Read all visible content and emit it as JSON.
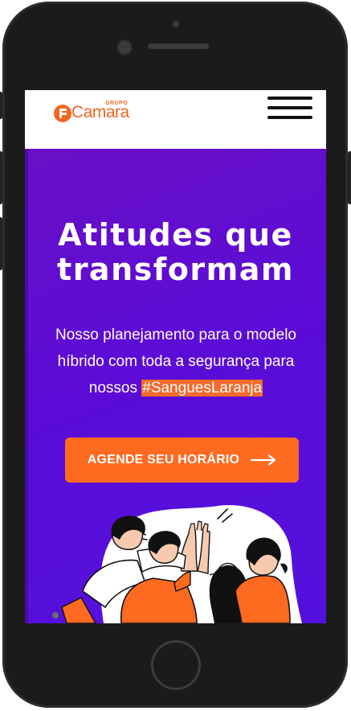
{
  "header": {
    "logo_name": "Camara",
    "logo_group": "GRUPO"
  },
  "hero": {
    "title_line1": "Atitudes que",
    "title_line2": "transformam",
    "subtitle_line1": "Nosso planejamento para o modelo",
    "subtitle_line2": "híbrido com toda a segurança para",
    "subtitle_line3_prefix": "nossos",
    "hashtag": "#SanguesLaranja",
    "cta_label": "AGENDE SEU HORÁRIO"
  },
  "icons": {
    "menu": "hamburger-menu-icon",
    "cta_arrow": "arrow-right-icon",
    "logo": "camara-logo-mark"
  },
  "colors": {
    "brand_orange": "#f26522",
    "cta_orange": "#ff6a21",
    "hero_purple": "#5b0cd6",
    "phone_body": "#1b1b1b"
  }
}
